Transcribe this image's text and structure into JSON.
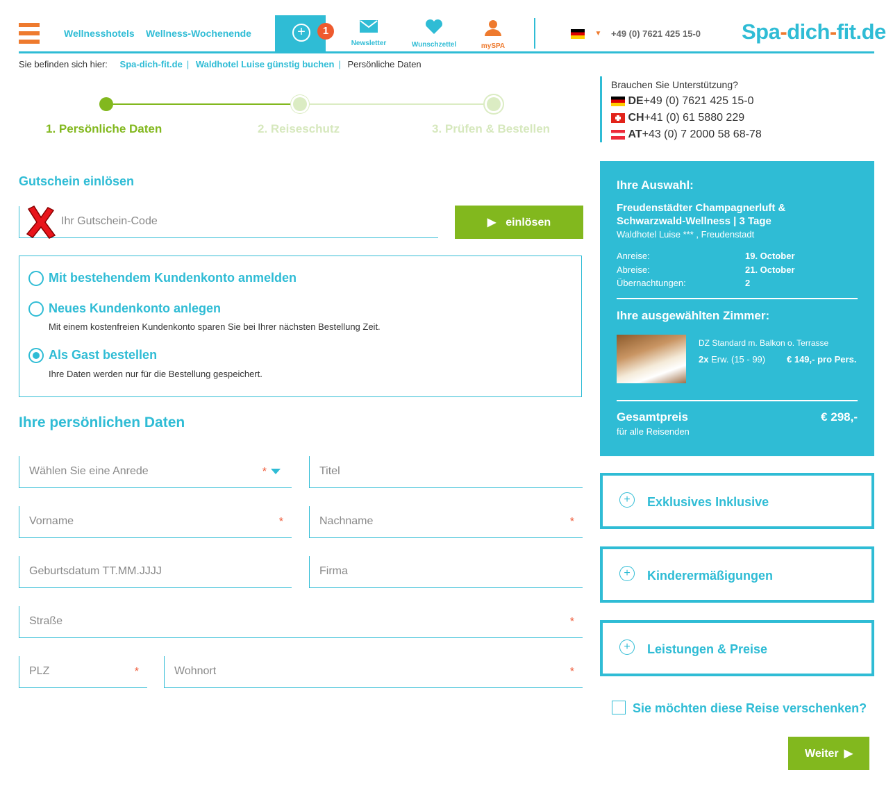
{
  "header": {
    "nav": [
      "Wellnesshotels",
      "Wellness-Wochenende"
    ],
    "badge_count": "1",
    "icons": [
      {
        "name": "envelope-icon",
        "label": "Newsletter"
      },
      {
        "name": "heart-icon",
        "label": "Wunschzettel"
      },
      {
        "name": "user-icon",
        "label": "mySPA"
      }
    ],
    "phone": "+49 (0) 7621 425 15-0",
    "logo": {
      "part1": "Spa",
      "dash": "-",
      "part2": "dich",
      "dash2": "-",
      "part3": "fit.de"
    }
  },
  "breadcrumb": {
    "prefix": "Sie befinden sich hier:",
    "items": [
      "Spa-dich-fit.de",
      "Waldhotel Luise günstig buchen",
      "Persönliche Daten"
    ]
  },
  "steps": [
    "1. Persönliche Daten",
    "2. Reiseschutz",
    "3. Prüfen & Bestellen"
  ],
  "voucher": {
    "title": "Gutschein einlösen",
    "placeholder": "Ihr Gutschein-Code",
    "button": "einlösen"
  },
  "account": {
    "options": [
      {
        "label": "Mit bestehendem Kundenkonto anmelden",
        "desc": ""
      },
      {
        "label": "Neues Kundenkonto anlegen",
        "desc": "Mit einem kostenfreien Kundenkonto sparen Sie bei Ihrer nächsten Bestellung Zeit."
      },
      {
        "label": "Als Gast bestellen",
        "desc": "Ihre Daten werden nur für die Bestellung gespeichert."
      }
    ]
  },
  "personal": {
    "title": "Ihre persönlichen Daten",
    "fields": {
      "anrede": "Wählen Sie eine Anrede",
      "titel": "Titel",
      "vorname": "Vorname",
      "nachname": "Nachname",
      "geburtsdatum": "Geburtsdatum TT.MM.JJJJ",
      "firma": "Firma",
      "strasse": "Straße",
      "plz": "PLZ",
      "wohnort": "Wohnort"
    },
    "required_mark": "*"
  },
  "support": {
    "title": "Brauchen Sie Unterstützung?",
    "lines": [
      {
        "cc": "DE",
        "num": "+49 (0) 7621 425 15-0"
      },
      {
        "cc": "CH",
        "num": "+41 (0) 61 5880 229"
      },
      {
        "cc": "AT",
        "num": "+43 (0) 7 2000 58 68-78"
      }
    ]
  },
  "selection": {
    "title": "Ihre Auswahl:",
    "offer": "Freudenstädter Champagnerluft & Schwarzwald-Wellness | 3 Tage",
    "hotel": "Waldhotel Luise *** , Freudenstadt",
    "rows": [
      {
        "k": "Anreise:",
        "v": "19. October"
      },
      {
        "k": "Abreise:",
        "v": "21. October"
      },
      {
        "k": "Übernachtungen:",
        "v": "2"
      }
    ],
    "rooms_title": "Ihre ausgewählten Zimmer:",
    "room_name": "DZ Standard m. Balkon o. Terrasse",
    "room_qty": "2x",
    "room_guests": "Erw. (15 - 99)",
    "room_price": "€ 149,- pro Pers.",
    "total_label": "Gesamtpreis",
    "total_sub": "für alle Reisenden",
    "total": "€ 298,-"
  },
  "accordions": [
    "Exklusives Inklusive",
    "Kinderermäßigungen",
    "Leistungen & Preise"
  ],
  "gift": "Sie möchten diese Reise verschenken?",
  "next_button": "Weiter",
  "colors": {
    "accent": "#2fbcd5",
    "green": "#82b81e",
    "orange": "#ee7a2e"
  }
}
